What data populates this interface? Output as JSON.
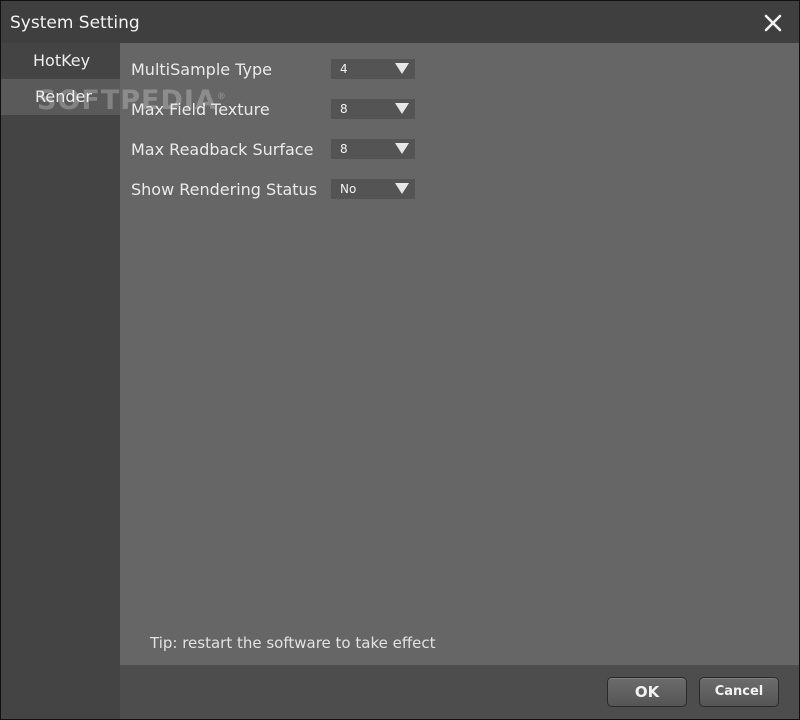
{
  "window": {
    "title": "System Setting",
    "close_icon": "close-icon"
  },
  "sidebar": {
    "items": [
      {
        "label": "HotKey",
        "selected": false
      },
      {
        "label": "Render",
        "selected": true
      }
    ]
  },
  "settings": {
    "rows": [
      {
        "label": "MultiSample Type",
        "value": "4"
      },
      {
        "label": "Max Field Texture",
        "value": "8"
      },
      {
        "label": "Max Readback Surface",
        "value": "8"
      },
      {
        "label": "Show Rendering Status",
        "value": "No"
      }
    ],
    "dropdown_icon": "dropdown-arrow-icon"
  },
  "tip": "Tip: restart the software to take effect",
  "buttons": {
    "ok": "OK",
    "cancel": "Cancel"
  },
  "watermark": "SOFTPEDIA",
  "colors": {
    "content_bg": "#666666",
    "sidebar_bg": "#444444",
    "selected_item_bg": "#5a5a5a",
    "select_bg": "#545454"
  }
}
